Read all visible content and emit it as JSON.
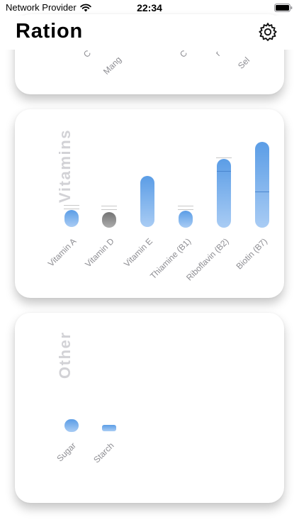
{
  "status_bar": {
    "carrier": "Network Provider",
    "time": "22:34"
  },
  "app": {
    "title": "Ration"
  },
  "icons": {
    "settings": "gear-icon",
    "wifi": "wifi-icon",
    "battery": "battery-icon"
  },
  "colors": {
    "bar_gradient_top": "#5b9de6",
    "bar_gradient_bottom": "#a9ccf4",
    "section_title": "#d2d2d6",
    "axis_label": "#8e8e93"
  },
  "cards": {
    "top_partial_labels": [
      "C",
      "Mang",
      "C",
      "r",
      "Sel"
    ],
    "vitamins": {
      "title": "Vitamins",
      "items": [
        {
          "label": "Vitamin A"
        },
        {
          "label": "Vitamin D"
        },
        {
          "label": "Vitamin E"
        },
        {
          "label": "Thiamine (B1)"
        },
        {
          "label": "Riboflavin (B2)"
        },
        {
          "label": "Biotin (B7)"
        }
      ]
    },
    "other": {
      "title": "Other",
      "items": [
        {
          "label": "Sugar"
        },
        {
          "label": "Starch"
        }
      ]
    }
  }
}
